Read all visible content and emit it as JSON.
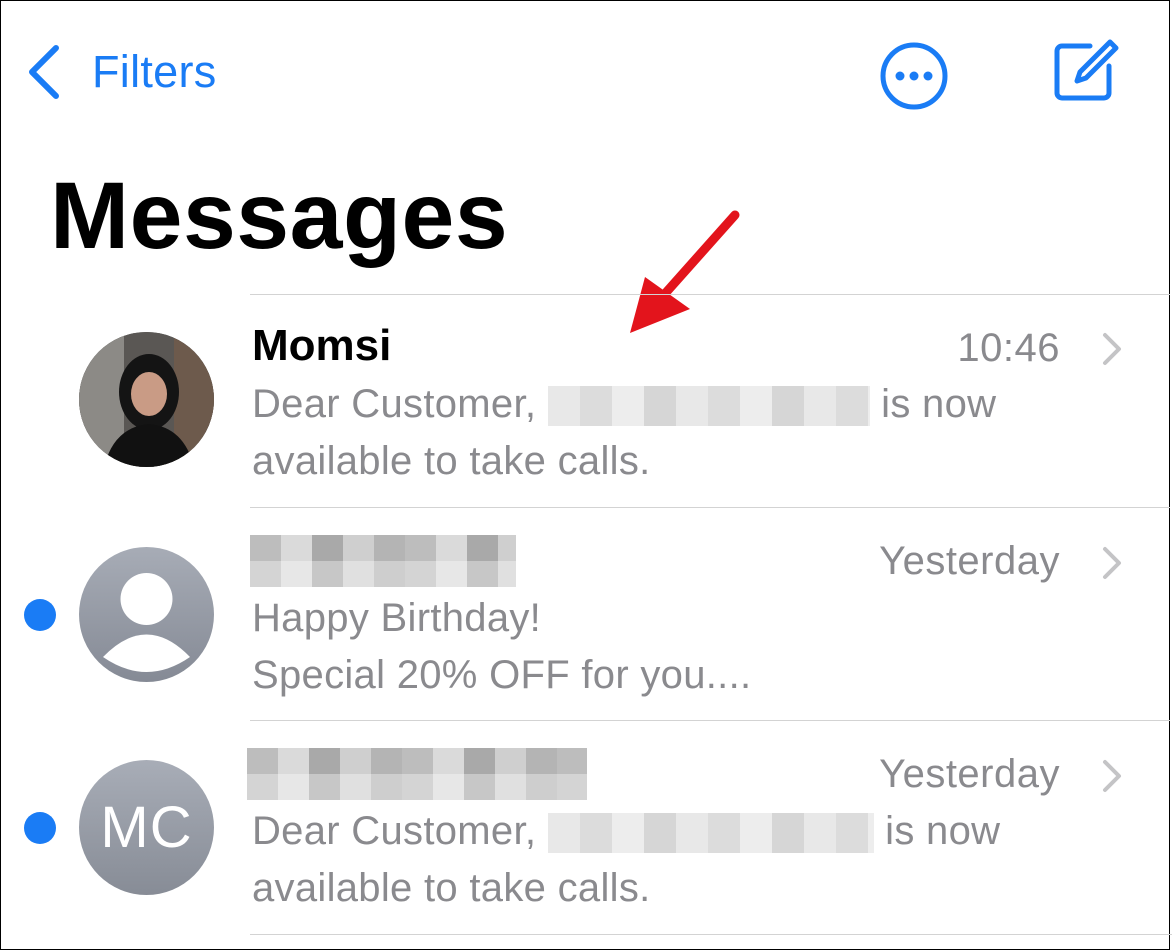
{
  "nav": {
    "back_label": "Filters",
    "accent_color": "#1a7cf5"
  },
  "header": {
    "title": "Messages"
  },
  "conversations": [
    {
      "name": "Momsi",
      "time": "10:46",
      "preview_before": "Dear Customer,",
      "preview_after": "is now",
      "preview_line2": "available to take calls.",
      "avatar": "photo",
      "unread": false
    },
    {
      "name": "",
      "time": "Yesterday",
      "preview_line1": "Happy Birthday!",
      "preview_line2": "Special 20% OFF for you....",
      "avatar": "person-silhouette-icon",
      "unread": true
    },
    {
      "name": "",
      "time": "Yesterday",
      "preview_before": "Dear Customer,",
      "preview_after": "is now",
      "preview_line2": "available to take calls.",
      "avatar_initials": "MC",
      "unread": true
    }
  ],
  "annotation": {
    "arrow_color": "#e3141c"
  }
}
